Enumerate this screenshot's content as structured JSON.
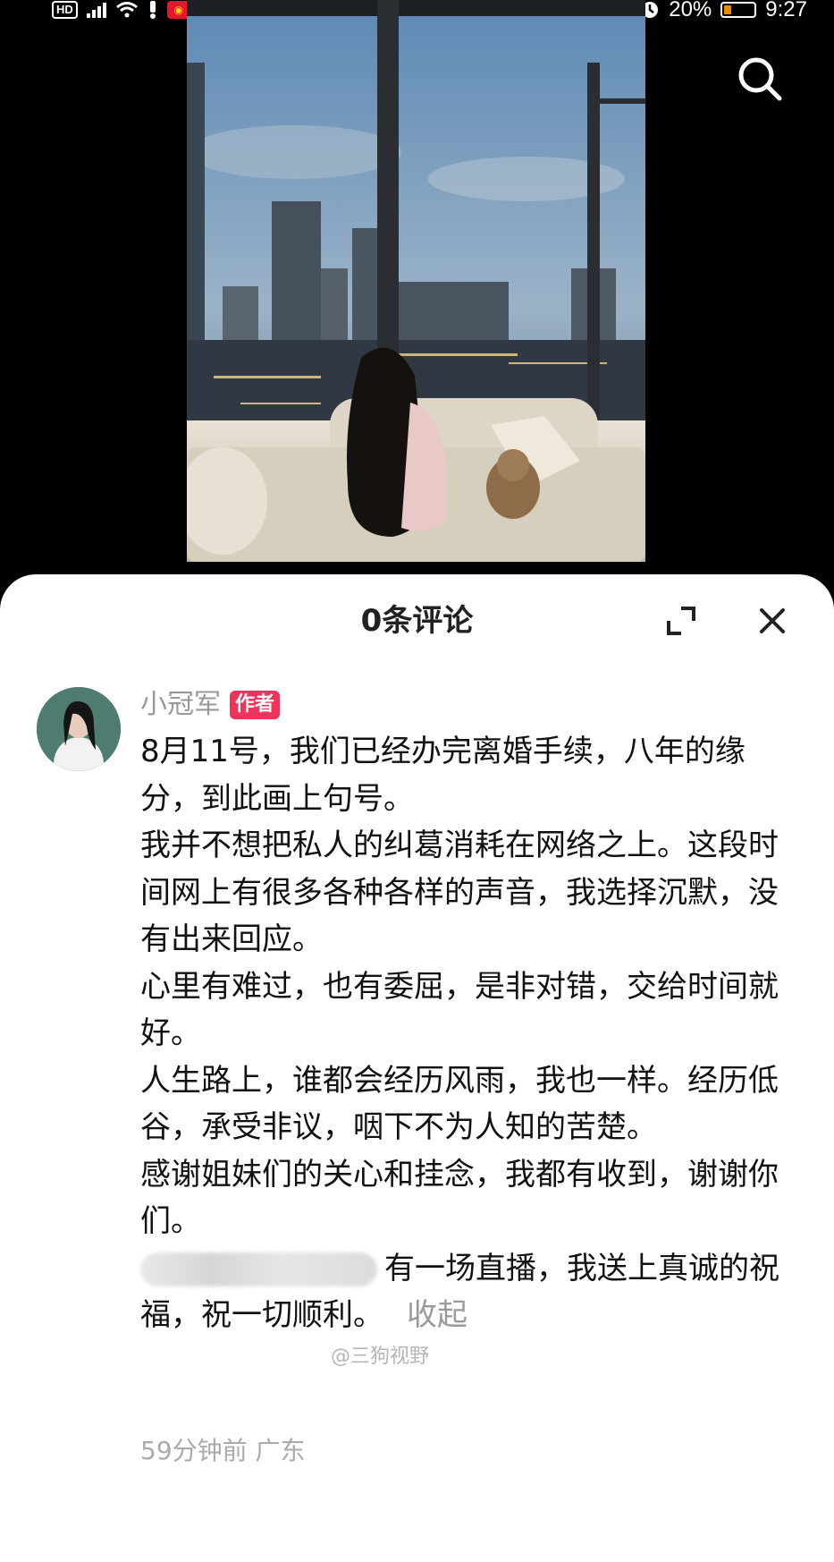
{
  "status_bar": {
    "hd": "HD",
    "battery": "20%",
    "time": "9:27",
    "icons": [
      "hd-icon",
      "signal-icon",
      "wifi-icon",
      "alert-icon",
      "weibo-icon",
      "eye-icon",
      "alarm-icon",
      "battery-icon"
    ]
  },
  "photo": {
    "icon_top_right": "search-icon"
  },
  "comments": {
    "title": "0条评论",
    "expand_icon": "expand-icon",
    "close_icon": "close-icon",
    "author": {
      "name": "小冠军",
      "badge": "作者"
    },
    "body_lines": [
      "8月11号，我们已经办完离婚手续，八年的缘分，到此画上句号。",
      "我并不想把私人的纠葛消耗在网络之上。这段时间网上有很多各种各样的声音，我选择沉默，没有出来回应。",
      "心里有难过，也有委屈，是非对错，交给时间就好。",
      "人生路上，谁都会经历风雨，我也一样。经历低谷，承受非议，咽下不为人知的苦楚。",
      "感谢姐妹们的关心和挂念，我都有收到，谢谢你们。"
    ],
    "last_line": "有一场直播，我送上真诚的祝福，祝一切顺利。",
    "collapse": "收起",
    "time_ago": "59分钟前",
    "location": "广东",
    "watermark": "@三狗视野"
  },
  "colors": {
    "author_badge": "#f0335a",
    "sheet_bg": "#ffffff",
    "muted_text": "#999999"
  }
}
